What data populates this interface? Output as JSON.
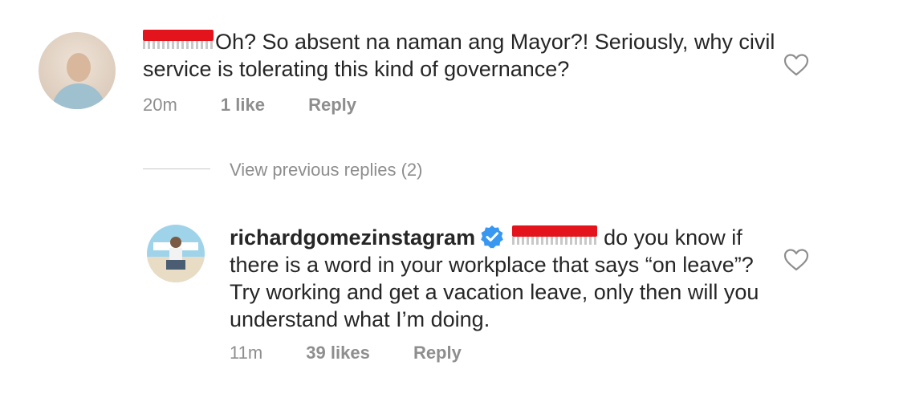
{
  "comment": {
    "text": "Oh? So absent na naman ang Mayor?! Seriously, why civil service is tolerating this kind of governance?",
    "time": "20m",
    "likes": "1 like",
    "reply_label": "Reply"
  },
  "view_previous_replies": "View previous replies (2)",
  "reply": {
    "username": "richardgomezinstagram",
    "text": "do you know if there is a word in your workplace that says “on leave”? Try working and get a vacation leave, only then will you understand what I’m doing.",
    "time": "11m",
    "likes": "39 likes",
    "reply_label": "Reply"
  },
  "colors": {
    "text": "#262626",
    "meta": "#8e8e8e",
    "redaction": "#e3141c",
    "verified": "#3897f0"
  },
  "icons": [
    "heart-icon",
    "verified-badge-icon"
  ]
}
